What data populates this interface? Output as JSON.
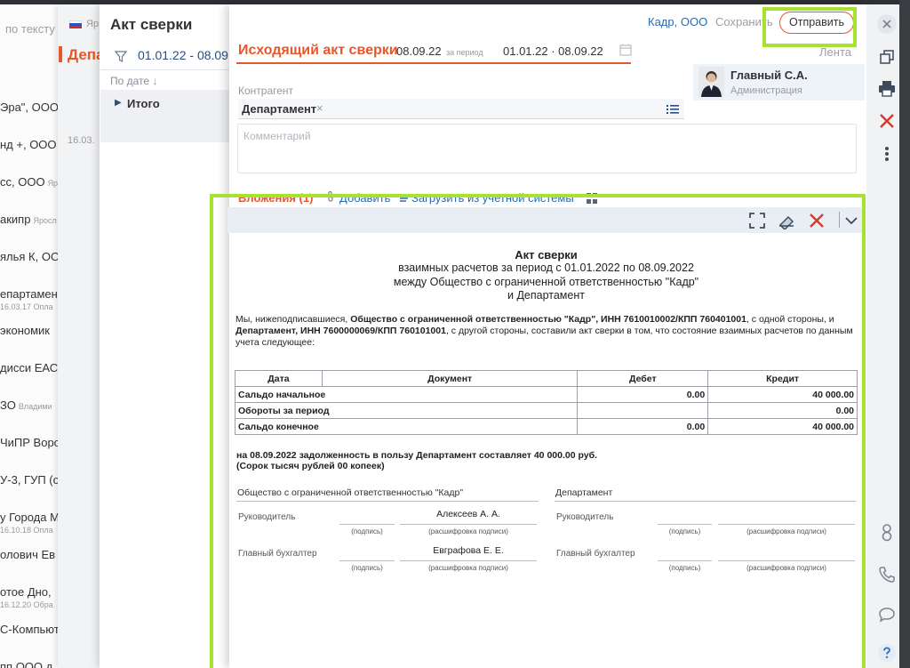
{
  "background_list": {
    "search_placeholder": "по тексту",
    "rows": [
      {
        "name": "Эра\", ООО",
        "tag": "",
        "sub": ""
      },
      {
        "name": "нд +, ООО",
        "tag": "",
        "sub": ""
      },
      {
        "name": "сс, ООО",
        "tag": "Яр",
        "sub": ""
      },
      {
        "name": "акипр",
        "tag": "Яросл",
        "sub": ""
      },
      {
        "name": "ялья К, ООО",
        "tag": "",
        "sub": ""
      },
      {
        "name": "епартамент",
        "tag": "",
        "sub": "16.03.17  Опла"
      },
      {
        "name": "экономик",
        "tag": "",
        "sub": ""
      },
      {
        "name": "дисси ЕАС,",
        "tag": "",
        "sub": ""
      },
      {
        "name": "ЗО",
        "tag": "Владими",
        "sub": ""
      },
      {
        "name": "ЧиПР Воро",
        "tag": "",
        "sub": ""
      },
      {
        "name": "У-3, ГУП (о",
        "tag": "",
        "sub": ""
      },
      {
        "name": "у Города М",
        "tag": "",
        "sub": "16.10.18  Опла"
      },
      {
        "name": "олович Ев",
        "tag": "",
        "sub": ""
      },
      {
        "name": "отое Дно, ",
        "tag": "",
        "sub": "16.12.20  Обра"
      },
      {
        "name": "С-Компьют",
        "tag": "",
        "sub": ""
      },
      {
        "name": "пп ООО д",
        "tag": "",
        "sub": ""
      }
    ]
  },
  "strip": {
    "region_tag": "Яр",
    "title": "Депа",
    "date": "16.03."
  },
  "panel": {
    "title": "Акт сверки",
    "filter_period": "01.01.22 - 08.09",
    "sort_label": "По дате ↓",
    "total_label": "Итого"
  },
  "modal": {
    "org_link": "Кадр, ООО",
    "save_label": "Сохранить",
    "send_label": "Отправить",
    "doc_title": "Исходящий акт сверки",
    "doc_date": "08.09.22",
    "period_label": "за период",
    "period_value": "01.01.22 · 08.09.22",
    "feed_label": "Лента",
    "user": {
      "name": "Главный С.А.",
      "role": "Администрация"
    },
    "counterparty": {
      "label": "Контрагент",
      "value": "Департамент",
      "clear": "×"
    },
    "comment_placeholder": "Комментарий",
    "attachments": {
      "title": "Вложения (1)",
      "add_label": "Добавить",
      "load_label": "Загрузить из учетной системы"
    }
  },
  "document": {
    "title": "Акт сверки",
    "subtitle": [
      "взаимных расчетов за период с 01.01.2022 по 08.09.2022",
      "между Общество с ограниченной ответственностью \"Кадр\"",
      "и Департамент"
    ],
    "intro": {
      "p1": "Мы, нижеподписавшиеся, ",
      "b1": "Общество с ограниченной ответственностью \"Кадр\", ИНН 7610010002/КПП 760401001",
      "p2": ", с одной стороны, и ",
      "b2": "Департамент, ИНН 7600000069/КПП 760101001",
      "p3": ", с другой стороны, составили акт сверки в том, что состояние взаимных расчетов по данным учета следующее:"
    },
    "table": {
      "headers": [
        "Дата",
        "Документ",
        "Дебет",
        "Кредит"
      ],
      "rows": [
        {
          "label": "Сальдо начальное",
          "debit": "0.00",
          "credit": "40 000.00"
        },
        {
          "label": "Обороты за период",
          "debit": "",
          "credit": "0.00"
        },
        {
          "label": "Сальдо конечное",
          "debit": "0.00",
          "credit": "40 000.00"
        }
      ]
    },
    "conclusion": [
      "на  08.09.2022 задолженность в пользу Департамент  составляет 40 000.00 руб.",
      "(Сорок тысяч рублей 00 копеек)"
    ],
    "signatures": {
      "left_party": "Общество с ограниченной ответственностью \"Кадр\"",
      "right_party": "Департамент",
      "head_label": "Руководитель",
      "accountant_label": "Главный бухгалтер",
      "sign_caption": "(подпись)",
      "decode_caption": "(расшифровка подписи)",
      "left_head_name": "Алексеев А. А.",
      "left_accountant_name": "Евграфова Е. Е."
    }
  },
  "rail": {
    "icons": [
      "close-icon",
      "copy-icon",
      "print-icon",
      "delete-icon",
      "more-icon",
      "contacts-icon",
      "phone-icon",
      "chat-icon",
      "help-icon"
    ]
  },
  "colors": {
    "accent": "#e8572a",
    "link": "#2b6cb0",
    "highlight": "#a6e22e",
    "danger": "#d33b2f"
  }
}
